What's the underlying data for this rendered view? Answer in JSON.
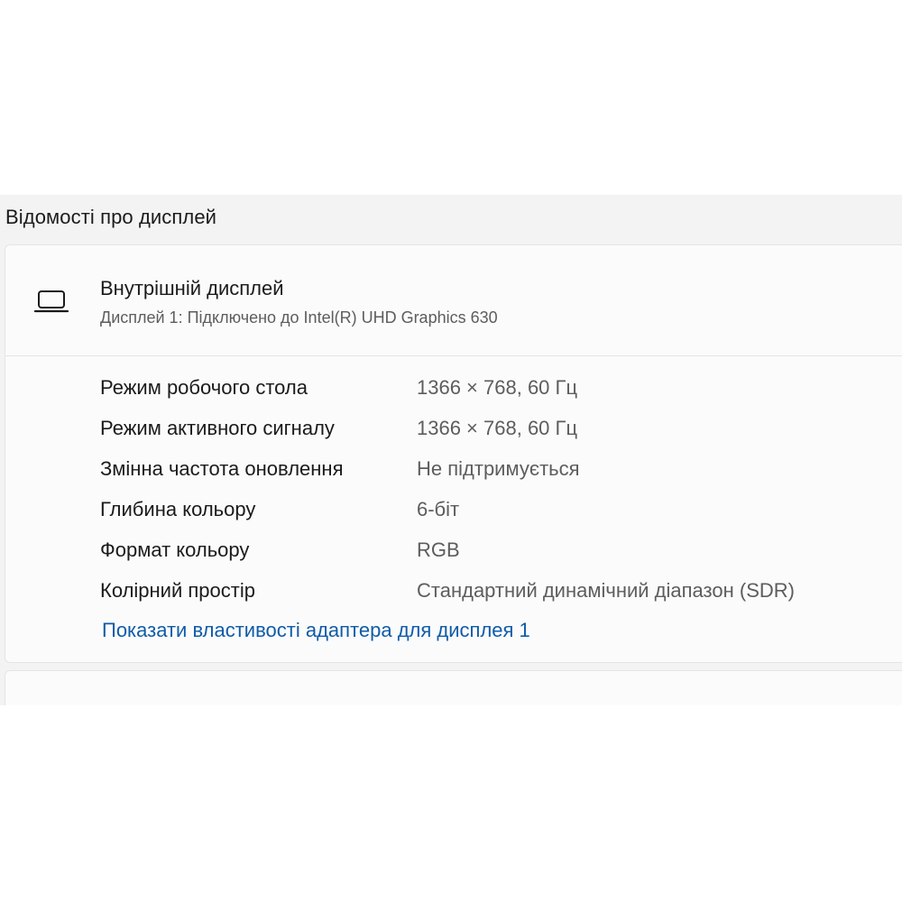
{
  "section_title": "Відомості про дисплей",
  "display": {
    "icon": "laptop-icon",
    "name": "Внутрішній дисплей",
    "description": "Дисплей 1: Підключено до Intel(R) UHD Graphics 630"
  },
  "properties": [
    {
      "label": "Режим робочого стола",
      "value": "1366 × 768, 60 Гц"
    },
    {
      "label": "Режим активного сигналу",
      "value": "1366 × 768, 60 Гц"
    },
    {
      "label": "Змінна частота оновлення",
      "value": "Не підтримується"
    },
    {
      "label": "Глибина кольору",
      "value": "6-біт"
    },
    {
      "label": "Формат кольору",
      "value": "RGB"
    },
    {
      "label": "Колірний простір",
      "value": "Стандартний динамічний діапазон (SDR)"
    }
  ],
  "adapter_link": "Показати властивості адаптера для дисплея 1",
  "colors": {
    "link": "#0f5ca8",
    "card_background": "#fbfbfb",
    "window_background": "#f3f3f3"
  }
}
